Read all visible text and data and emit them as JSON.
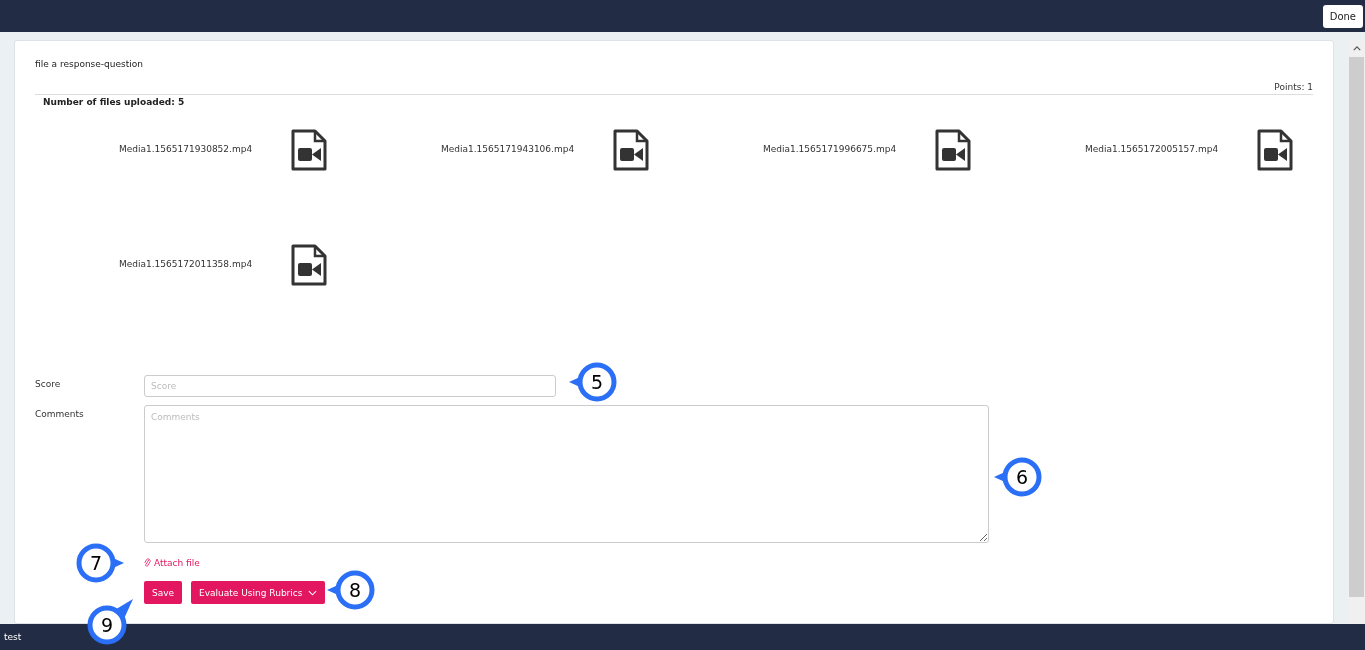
{
  "top_bar": {
    "done_button": "Done"
  },
  "question": {
    "title": "file a response-question",
    "points": "Points: 1",
    "files_count": "Number of files uploaded: 5"
  },
  "files": [
    {
      "name": "Media1.1565171930852.mp4"
    },
    {
      "name": "Media1.1565171943106.mp4"
    },
    {
      "name": "Media1.1565171996675.mp4"
    },
    {
      "name": "Media1.1565172005157.mp4"
    },
    {
      "name": "Media1.1565172011358.mp4"
    }
  ],
  "score": {
    "label": "Score",
    "placeholder": "Score"
  },
  "comments": {
    "label": "Comments",
    "placeholder": "Comments"
  },
  "attach_link": "Attach file",
  "buttons": {
    "save": "Save",
    "rubrics": "Evaluate Using Rubrics"
  },
  "callouts": [
    {
      "number": "5",
      "kind": "left"
    },
    {
      "number": "6",
      "kind": "left"
    },
    {
      "number": "7",
      "kind": "right"
    },
    {
      "number": "8",
      "kind": "left"
    },
    {
      "number": "9",
      "kind": "up"
    }
  ],
  "status_bar": {
    "text": "test"
  }
}
